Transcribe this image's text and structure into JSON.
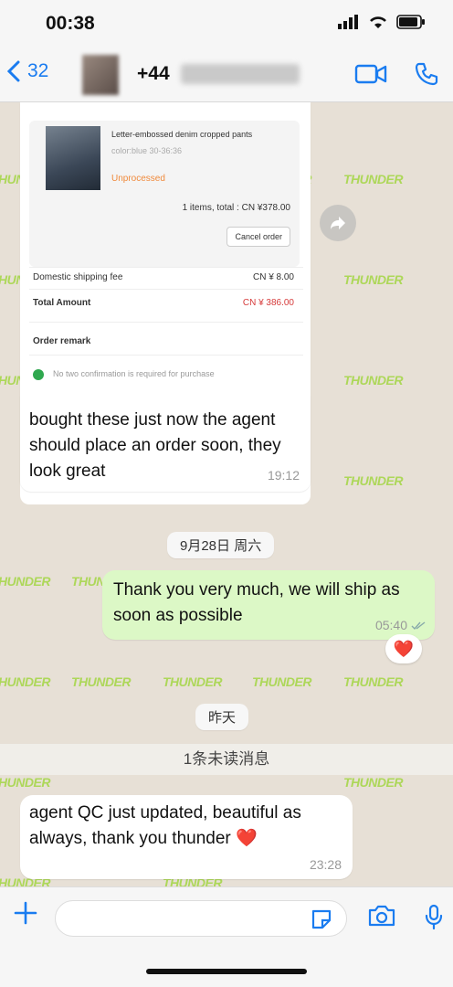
{
  "status": {
    "time": "00:38"
  },
  "nav": {
    "back_count": "32",
    "contact": "+44"
  },
  "watermark": "THUNDER",
  "order": {
    "product_title": "Letter-embossed denim cropped pants",
    "product_color": "color:blue 30-36:36",
    "product_status": "Unprocessed",
    "items_total": "1 items, total : CN ¥378.00",
    "cancel_label": "Cancel order",
    "shipping_label": "Domestic shipping fee",
    "shipping_value": "CN ¥ 8.00",
    "total_label": "Total Amount",
    "total_value": "CN ¥ 386.00",
    "remark_label": "Order remark",
    "confirm_note": "No two confirmation is required for purchase"
  },
  "messages": [
    {
      "text": "bought these just now the agent should place an order soon, they look great",
      "time": "19:12"
    },
    {
      "text": "Thank you very much, we will ship as soon as possible",
      "time": "05:40"
    },
    {
      "text": "agent QC just updated, beautiful as always, thank you thunder ❤️",
      "time": "23:28"
    }
  ],
  "dates": {
    "first": "9月28日 周六",
    "second": "昨天"
  },
  "unread": "1条未读消息",
  "reaction": "❤️",
  "colors": {
    "accent": "#1a7cf0",
    "outgoing": "#dcf8c6",
    "watermark": "#9fd63a"
  }
}
